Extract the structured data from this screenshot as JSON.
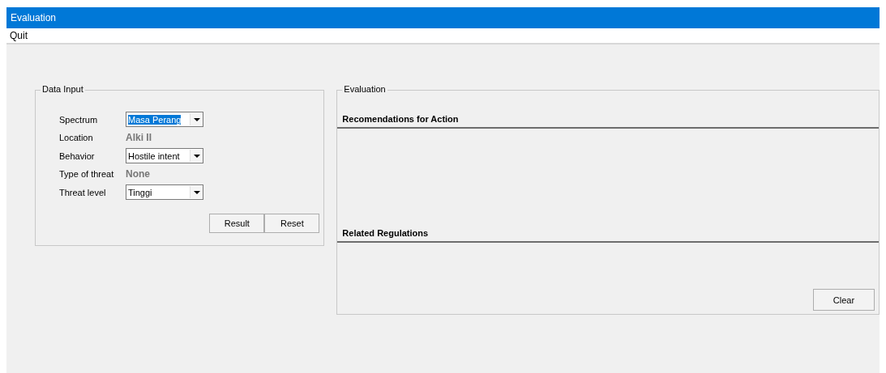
{
  "window": {
    "title": "Evaluation"
  },
  "menu": [
    {
      "label": "Quit"
    }
  ],
  "data_input": {
    "title": "Data Input",
    "rows": [
      {
        "kind": "combo",
        "label": "Spectrum",
        "value": "Masa Perang",
        "selected": true
      },
      {
        "kind": "readonly",
        "label": "Location",
        "value": "Alki II"
      },
      {
        "kind": "combo",
        "label": "Behavior",
        "value": "Hostile intent",
        "selected": false
      },
      {
        "kind": "readonly",
        "label": "Type of threat",
        "value": "None"
      },
      {
        "kind": "combo",
        "label": "Threat level",
        "value": "Tinggi",
        "selected": false
      }
    ],
    "buttons": [
      "Result",
      "Reset"
    ]
  },
  "evaluation": {
    "title": "Evaluation",
    "sections": [
      {
        "heading": "Recomendations for Action"
      },
      {
        "heading": "Related Regulations"
      }
    ],
    "buttons": [
      "Clear"
    ]
  }
}
